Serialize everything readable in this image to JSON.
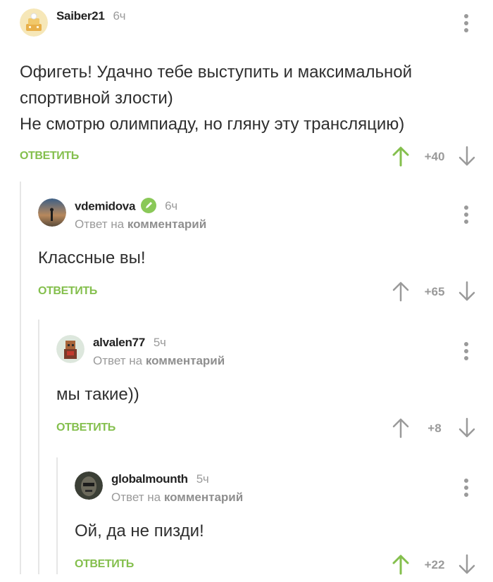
{
  "comments": [
    {
      "username": "Saiber21",
      "time": "6ч",
      "reply_label": "",
      "reply_target": "",
      "text_lines": [
        "Офигеть! Удачно тебе выступить и максимальной",
        "спортивной злости)",
        "Не смотрю олимпиаду, но гляну эту трансляцию)"
      ],
      "reply_button": "ОТВЕТИТЬ",
      "rating": "+40",
      "upvoted": true
    },
    {
      "username": "vdemidova",
      "time": "6ч",
      "verified_icon": "pencil-badge-icon",
      "reply_label": "Ответ на",
      "reply_target": "комментарий",
      "text_lines": [
        "Классные вы!"
      ],
      "reply_button": "ОТВЕТИТЬ",
      "rating": "+65",
      "upvoted": false
    },
    {
      "username": "alvalen77",
      "time": "5ч",
      "reply_label": "Ответ на",
      "reply_target": "комментарий",
      "text_lines": [
        "мы такие))"
      ],
      "reply_button": "ОТВЕТИТЬ",
      "rating": "+8",
      "upvoted": false
    },
    {
      "username": "globalmounth",
      "time": "5ч",
      "reply_label": "Ответ на",
      "reply_target": "комментарий",
      "text_lines": [
        "Ой, да не пизди!"
      ],
      "reply_button": "ОТВЕТИТЬ",
      "rating": "+22",
      "upvoted": true
    }
  ],
  "colors": {
    "accent_green": "#84bf4d",
    "muted_gray": "#9a9a9a",
    "thread_line": "#e6e6e6"
  }
}
